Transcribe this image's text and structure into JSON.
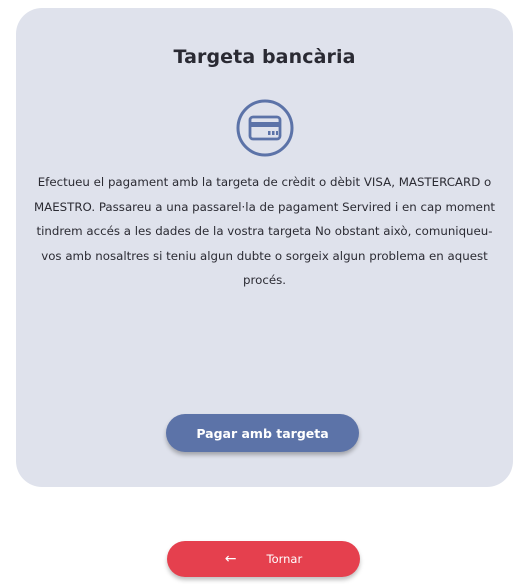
{
  "card": {
    "title": "Targeta bancària",
    "icon": "credit-card-icon",
    "description": "Efectueu el pagament amb la targeta de crèdit o dèbit VISA, MASTERCARD o MAESTRO. Passareu a una passarel·la de pagament Servired i en cap moment tindrem accés a les dades de la vostra targeta No obstant això, comuniqueu-vos amb nosaltres si teniu algun dubte o sorgeix algun problema en aquest procés.",
    "pay_button_label": "Pagar amb targeta"
  },
  "back_button": {
    "icon": "arrow-left-icon",
    "arrow_glyph": "←",
    "label": "Tornar"
  },
  "colors": {
    "card_background": "#dfe2ec",
    "primary": "#5c73a8",
    "danger": "#e5404e",
    "text": "#2b2b33"
  }
}
